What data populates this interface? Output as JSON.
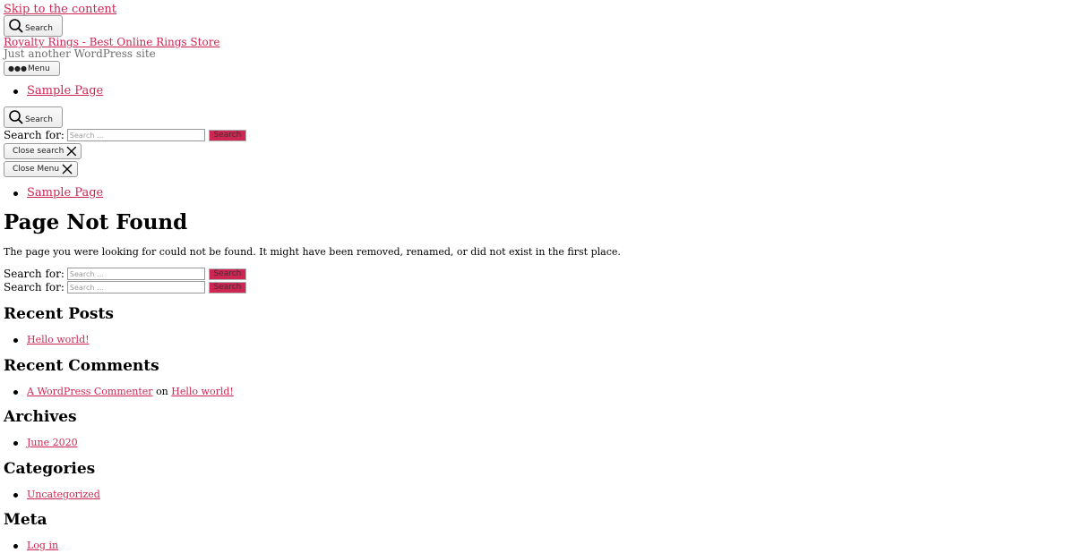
{
  "skip_link": "Skip to the content",
  "header": {
    "search_toggle_label": "Search",
    "site_title": "Royalty Rings - Best Online Rings Store",
    "site_description": "Just another WordPress site",
    "menu_toggle_label": "Menu"
  },
  "primary_menu": [
    {
      "label": "Sample Page"
    }
  ],
  "search_modal": {
    "toggle_label": "Search",
    "form": {
      "label": "Search for:",
      "placeholder": "Search …",
      "submit": "Search"
    },
    "close_label": "Close search"
  },
  "menu_modal": {
    "close_label": "Close Menu",
    "items": [
      {
        "label": "Sample Page"
      }
    ]
  },
  "main": {
    "title": "Page Not Found",
    "message": "The page you were looking for could not be found. It might have been removed, renamed, or did not exist in the first place.",
    "search_forms": [
      {
        "label": "Search for:",
        "placeholder": "Search …",
        "submit": "Search"
      },
      {
        "label": "Search for:",
        "placeholder": "Search …",
        "submit": "Search"
      }
    ]
  },
  "widgets": {
    "recent_posts": {
      "title": "Recent Posts",
      "items": [
        {
          "label": "Hello world!"
        }
      ]
    },
    "recent_comments": {
      "title": "Recent Comments",
      "items": [
        {
          "author": "A WordPress Commenter",
          "on": "on",
          "post": "Hello world!"
        }
      ]
    },
    "archives": {
      "title": "Archives",
      "items": [
        {
          "label": "June 2020"
        }
      ]
    },
    "categories": {
      "title": "Categories",
      "items": [
        {
          "label": "Uncategorized"
        }
      ]
    },
    "meta": {
      "title": "Meta",
      "items": [
        {
          "label": "Log in"
        }
      ]
    }
  },
  "colors": {
    "accent": "#cd2653",
    "muted_text": "#6d6d6d"
  }
}
